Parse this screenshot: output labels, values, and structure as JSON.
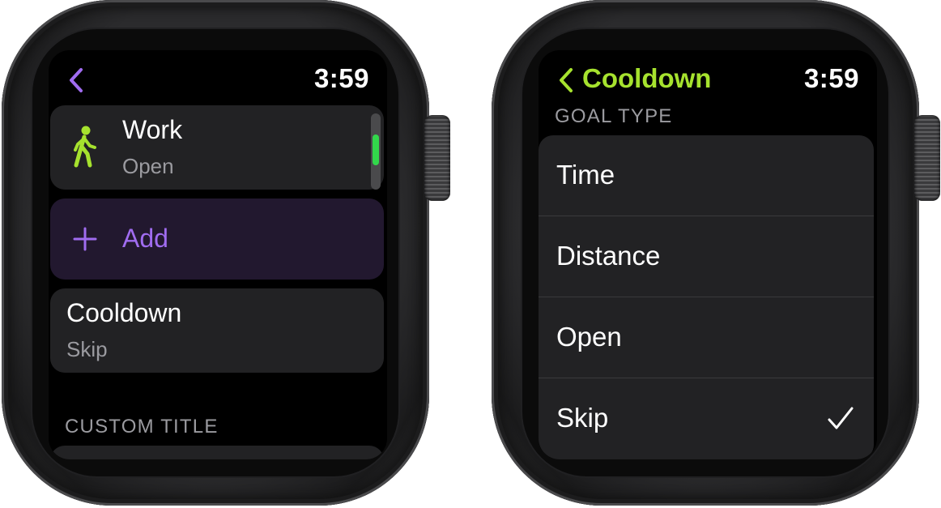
{
  "left_watch": {
    "time": "3:59",
    "work_row": {
      "title": "Work",
      "subtitle": "Open"
    },
    "add_button": {
      "label": "Add"
    },
    "cooldown_row": {
      "title": "Cooldown",
      "subtitle": "Skip"
    },
    "section_header": "CUSTOM TITLE"
  },
  "right_watch": {
    "time": "3:59",
    "nav_title": "Cooldown",
    "section_header": "GOAL TYPE",
    "options": [
      {
        "label": "Time"
      },
      {
        "label": "Distance"
      },
      {
        "label": "Open"
      },
      {
        "label": "Skip",
        "selected": true
      }
    ]
  },
  "colors": {
    "accent_purple": "#a06cf0",
    "accent_green": "#a6e22e",
    "scroll_green": "#32d74b"
  }
}
